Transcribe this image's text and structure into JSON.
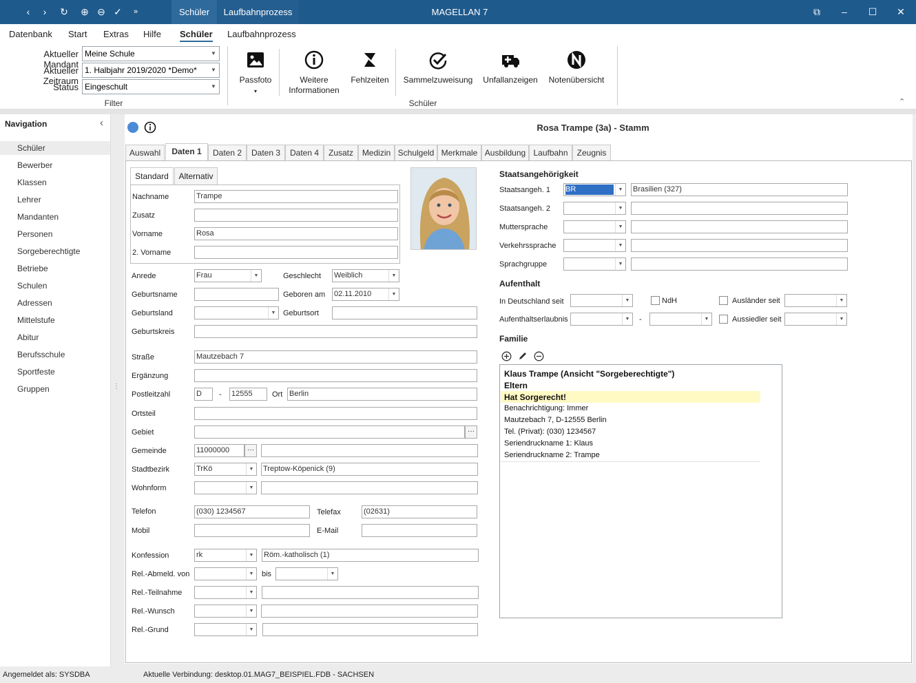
{
  "app": {
    "title": "MAGELLAN 7"
  },
  "titlebar": {
    "context_tabs": [
      "Schüler",
      "Laufbahnprozess"
    ]
  },
  "menu": {
    "items": [
      "Datenbank",
      "Start",
      "Extras",
      "Hilfe",
      "Schüler",
      "Laufbahnprozess"
    ],
    "active": "Schüler"
  },
  "filter": {
    "mandant_label": "Aktueller Mandant",
    "mandant_value": "Meine Schule",
    "zeitraum_label": "Aktueller Zeitraum",
    "zeitraum_value": "1. Halbjahr 2019/2020 *Demo*",
    "status_label": "Status",
    "status_value": "Eingeschult",
    "group_label": "Filter"
  },
  "ribbon": {
    "passfoto": "Passfoto",
    "weitere_1": "Weitere",
    "weitere_2": "Informationen",
    "fehlzeiten": "Fehlzeiten",
    "sammelzuweisung": "Sammelzuweisung",
    "unfallanzeigen": "Unfallanzeigen",
    "notenuebersicht": "Notenübersicht",
    "group_label": "Schüler"
  },
  "nav": {
    "title": "Navigation",
    "items": [
      "Schüler",
      "Bewerber",
      "Klassen",
      "Lehrer",
      "Mandanten",
      "Personen",
      "Sorgeberechtigte",
      "Betriebe",
      "Schulen",
      "Adressen",
      "Mittelstufe",
      "Abitur",
      "Berufsschule",
      "Sportfeste",
      "Gruppen"
    ],
    "selected": "Schüler"
  },
  "record": {
    "title": "Rosa Trampe (3a) - Stamm"
  },
  "tabs": [
    "Auswahl",
    "Daten 1",
    "Daten 2",
    "Daten 3",
    "Daten 4",
    "Zusatz",
    "Medizin",
    "Schulgeld",
    "Merkmale",
    "Ausbildung",
    "Laufbahn",
    "Zeugnis"
  ],
  "subtabs": [
    "Standard",
    "Alternativ"
  ],
  "form": {
    "nachname_label": "Nachname",
    "nachname": "Trampe",
    "zusatz_label": "Zusatz",
    "zusatz": "",
    "vorname_label": "Vorname",
    "vorname": "Rosa",
    "vorname2_label": "2. Vorname",
    "vorname2": "",
    "anrede_label": "Anrede",
    "anrede": "Frau",
    "geschlecht_label": "Geschlecht",
    "geschlecht": "Weiblich",
    "geburtsname_label": "Geburtsname",
    "geboren_label": "Geboren am",
    "geboren": "02.11.2010",
    "geburtsland_label": "Geburtsland",
    "geburtsort_label": "Geburtsort",
    "geburtskreis_label": "Geburtskreis",
    "strasse_label": "Straße",
    "strasse": "Mautzebach 7",
    "ergaenzung_label": "Ergänzung",
    "plz_label": "Postleitzahl",
    "plz_land": "D",
    "plz_dash": "-",
    "plz": "12555",
    "ort_label": "Ort",
    "ort": "Berlin",
    "ortsteil_label": "Ortsteil",
    "gebiet_label": "Gebiet",
    "gemeinde_label": "Gemeinde",
    "gemeinde": "11000000",
    "stadtbezirk_label": "Stadtbezirk",
    "stadtbezirk": "TrKö",
    "stadtbezirk_text": "Treptow-Köpenick (9)",
    "wohnform_label": "Wohnform",
    "telefon_label": "Telefon",
    "telefon": "(030) 1234567",
    "telefax_label": "Telefax",
    "telefax": "(02631)",
    "mobil_label": "Mobil",
    "email_label": "E-Mail",
    "konfession_label": "Konfession",
    "konfession": "rk",
    "konfession_text": "Röm.-katholisch (1)",
    "relabmeld_label": "Rel.-Abmeld. von",
    "bis_label": "bis",
    "relteil_label": "Rel.-Teilnahme",
    "relwunsch_label": "Rel.-Wunsch",
    "relgrund_label": "Rel.-Grund"
  },
  "right": {
    "staat_header": "Staatsangehörigkeit",
    "staat1_label": "Staatsangeh. 1",
    "staat1_code": "BR",
    "staat1_text": "Brasilien (327)",
    "staat2_label": "Staatsangeh. 2",
    "mutter_label": "Muttersprache",
    "verkehr_label": "Verkehrssprache",
    "sprachgruppe_label": "Sprachgruppe",
    "aufenthalt_header": "Aufenthalt",
    "indeutschland_label": "In Deutschland seit",
    "ndh_label": "NdH",
    "auslaender_label": "Ausländer seit",
    "erlaubnis_label": "Aufenthaltserlaubnis",
    "erlaubnis_dash": "-",
    "aussiedler_label": "Aussiedler seit",
    "familie_header": "Familie",
    "family": [
      "Klaus Trampe (Ansicht \"Sorgeberechtigte\")",
      "Eltern",
      "Hat Sorgerecht!",
      "Benachrichtigung: Immer",
      "Mautzebach 7, D-12555 Berlin",
      "Tel. (Privat): (030) 1234567",
      "Seriendruckname 1: Klaus",
      "Seriendruckname 2: Trampe"
    ]
  },
  "status": {
    "user": "Angemeldet als: SYSDBA",
    "connection": "Aktuelle Verbindung: desktop.01.MAG7_BEISPIEL.FDB - SACHSEN"
  },
  "colors": {
    "titlebar": "#1f5a8c",
    "highlight": "#fff9c4",
    "selected_field": "#2f6fc4"
  }
}
